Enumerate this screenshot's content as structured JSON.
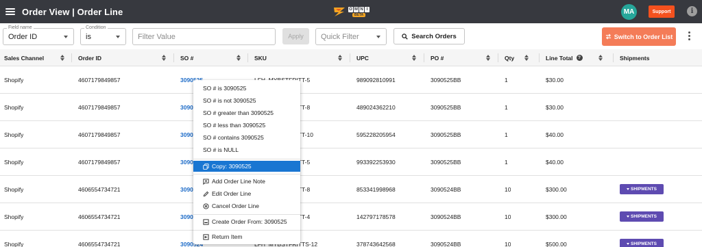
{
  "header": {
    "title": "Order View | Order Line",
    "logo_letters": [
      "O",
      "M",
      "N",
      "I"
    ],
    "logo_badge": "BETA",
    "avatar_initials": "MA",
    "support_label": "Support",
    "info_glyph": "i"
  },
  "filters": {
    "field_name_legend": "Field name",
    "field_name_value": "Order ID",
    "condition_legend": "Condition",
    "condition_value": "is",
    "filter_value_placeholder": "Filter Value",
    "apply_label": "Apply",
    "quick_filter_placeholder": "Quick Filter",
    "search_label": "Search Orders",
    "switch_label": "Switch to Order List"
  },
  "table": {
    "columns": [
      "Sales Channel",
      "Order ID",
      "SO #",
      "SKU",
      "UPC",
      "PO #",
      "Qty",
      "Line Total",
      "Shipments"
    ],
    "rows": [
      {
        "channel": "Shopify",
        "order_id": "4607179849857",
        "so": "3090525",
        "sku": "LFH_MYBSTFRITT-5",
        "upc": "989092810991",
        "po": "3090525BB",
        "qty": "1",
        "total": "$30.00",
        "shipments": ""
      },
      {
        "channel": "Shopify",
        "order_id": "4607179849857",
        "so": "3090525",
        "sku": "LFH_MYBSTFRITT-8",
        "upc": "489024362210",
        "po": "3090525BB",
        "qty": "1",
        "total": "$30.00",
        "shipments": ""
      },
      {
        "channel": "Shopify",
        "order_id": "4607179849857",
        "so": "3090525",
        "sku": "LFH_MYBSTFRITT-10",
        "upc": "595228205954",
        "po": "3090525BB",
        "qty": "1",
        "total": "$40.00",
        "shipments": ""
      },
      {
        "channel": "Shopify",
        "order_id": "4607179849857",
        "so": "3090525",
        "sku": "LFH_MYBSTFRITT-5",
        "upc": "993392253930",
        "po": "3090525BB",
        "qty": "1",
        "total": "$40.00",
        "shipments": ""
      },
      {
        "channel": "Shopify",
        "order_id": "4606554734721",
        "so": "3090524",
        "sku": "LFH_MYBSTFRITT-8",
        "upc": "853341998968",
        "po": "3090524BB",
        "qty": "10",
        "total": "$300.00",
        "shipments": "SHIPMENTS"
      },
      {
        "channel": "Shopify",
        "order_id": "4606554734721",
        "so": "3090524",
        "sku": "LFH_MYBSTFRITT-4",
        "upc": "142797178578",
        "po": "3090524BB",
        "qty": "10",
        "total": "$300.00",
        "shipments": "SHIPMENTS"
      },
      {
        "channel": "Shopify",
        "order_id": "4606554734721",
        "so": "3090524",
        "sku": "LFH_MYBSTFRITTS-12",
        "upc": "378743642568",
        "po": "3090524BB",
        "qty": "10",
        "total": "$500.00",
        "shipments": "SHIPMENTS"
      }
    ]
  },
  "context_menu": {
    "items": [
      "SO # is 3090525",
      "SO # is not 3090525",
      "SO # greater than 3090525",
      "SO # less than 3090525",
      "SO # contains 3090525",
      "SO # is NULL"
    ],
    "copy_label": "Copy: 3090525",
    "actions": [
      "Add Order Line Note",
      "Edit Order Line",
      "Cancel Order Line"
    ],
    "create_label": "Create Order From: 3090525",
    "return_label": "Return Item"
  },
  "colors": {
    "topbar": "#37393f",
    "accent_orange": "#f47c58",
    "support_red": "#f4511e",
    "link_blue": "#1e6cc8",
    "shipments_purple": "#5e4bb1",
    "menu_selected": "#1976d2",
    "avatar_teal": "#26a69a"
  }
}
